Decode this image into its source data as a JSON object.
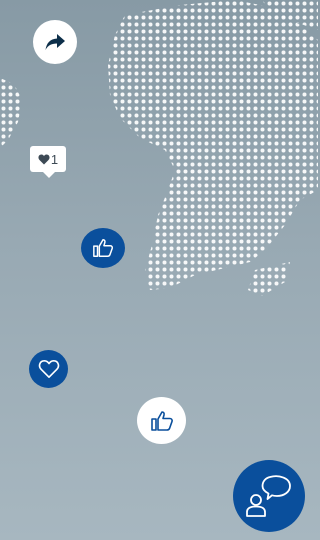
{
  "background": {
    "gradient_top": "#879aa5",
    "gradient_bottom": "#a7b7c0",
    "dot_color": "#ffffff",
    "map_region": "world-map-dotted"
  },
  "actions": {
    "share": {
      "icon": "share-arrow-icon"
    },
    "likes": {
      "icon": "heart-icon",
      "count": "1"
    },
    "like_blue": {
      "icon": "thumbs-up-icon"
    },
    "favorite": {
      "icon": "heart-outline-icon"
    },
    "like_white": {
      "icon": "thumbs-up-icon"
    },
    "chat": {
      "icon": "chat-user-icon"
    }
  },
  "colors": {
    "accent": "#0a4f9c",
    "white": "#ffffff"
  }
}
